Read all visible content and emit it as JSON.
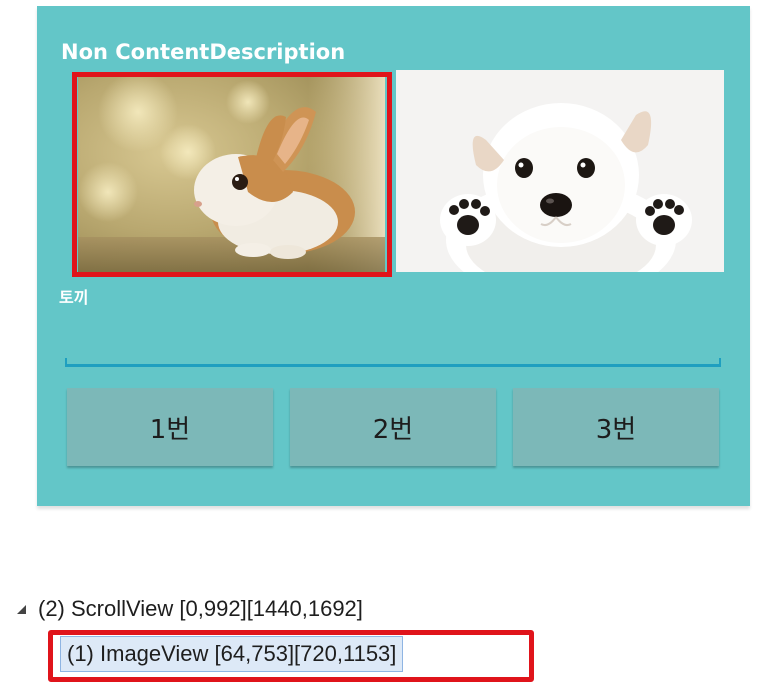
{
  "app_screen": {
    "title": "Non ContentDescription",
    "images": [
      {
        "subject": "rabbit-icon"
      },
      {
        "subject": "puppy-icon"
      }
    ],
    "caption": "토끼",
    "input": {
      "value": "",
      "placeholder": ""
    },
    "buttons": [
      {
        "label": "1번"
      },
      {
        "label": "2번"
      },
      {
        "label": "3번"
      }
    ]
  },
  "hierarchy": {
    "parent": {
      "label": "(2) ScrollView [0,992][1440,1692]"
    },
    "child": {
      "label": "(1) ImageView [64,753][720,1153]"
    }
  },
  "colors": {
    "panel": "#63c6c8",
    "button": "#7cb8b8",
    "highlight": "#e0141b",
    "input_line": "#1f9fc0",
    "tree_selection": "#dde9f7"
  }
}
